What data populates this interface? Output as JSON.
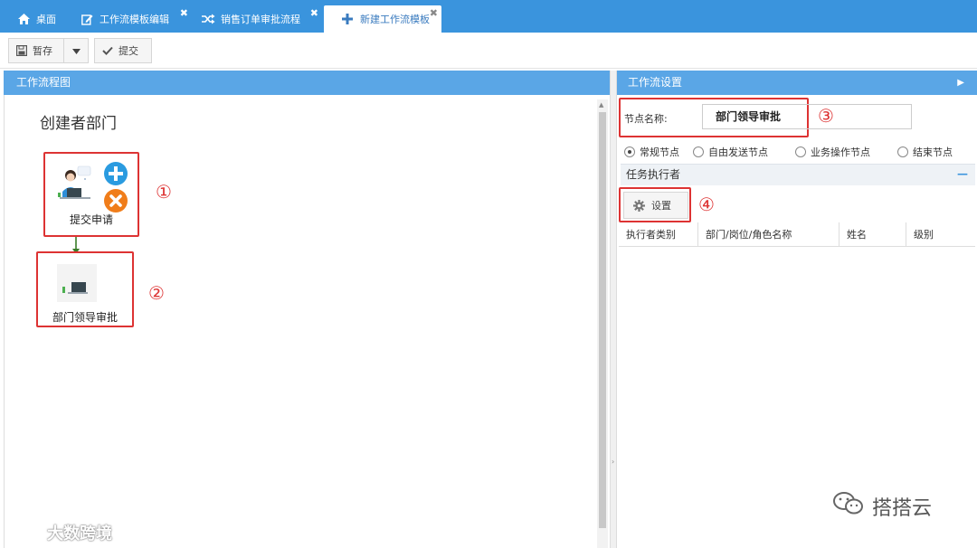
{
  "tabs": [
    {
      "label": "桌面",
      "icon": "home-icon",
      "closable": false,
      "active": false
    },
    {
      "label": "工作流模板编辑",
      "icon": "edit-icon",
      "closable": true,
      "active": false
    },
    {
      "label": "销售订单审批流程",
      "icon": "shuffle-icon",
      "closable": true,
      "active": false
    },
    {
      "label": "新建工作流模板",
      "icon": "plus-icon",
      "closable": true,
      "active": true
    }
  ],
  "toolbar": {
    "save_label": "暂存",
    "submit_label": "提交"
  },
  "left_panel": {
    "title": "工作流程图",
    "department": "创建者部门",
    "nodes": [
      {
        "label": "提交申请",
        "annotation": "①"
      },
      {
        "label": "部门领导审批",
        "annotation": "②"
      }
    ]
  },
  "right_panel": {
    "title": "工作流设置",
    "node_name_label": "节点名称:",
    "node_name_value": "部门领导审批",
    "annotation_name": "③",
    "node_types": [
      {
        "label": "常规节点",
        "selected": true
      },
      {
        "label": "自由发送节点",
        "selected": false
      },
      {
        "label": "业务操作节点",
        "selected": false
      },
      {
        "label": "结束节点",
        "selected": false
      }
    ],
    "section_title": "任务执行者",
    "settings_label": "设置",
    "annotation_settings": "④",
    "columns": [
      "执行者类别",
      "部门/岗位/角色名称",
      "姓名",
      "级别"
    ]
  },
  "watermarks": {
    "left": "大数跨境",
    "right": "搭搭云"
  },
  "colors": {
    "accent": "#3a94dd",
    "header": "#5aa6e6",
    "annotation": "#dd3333",
    "add": "#2a9be0",
    "remove": "#f07d1a"
  }
}
